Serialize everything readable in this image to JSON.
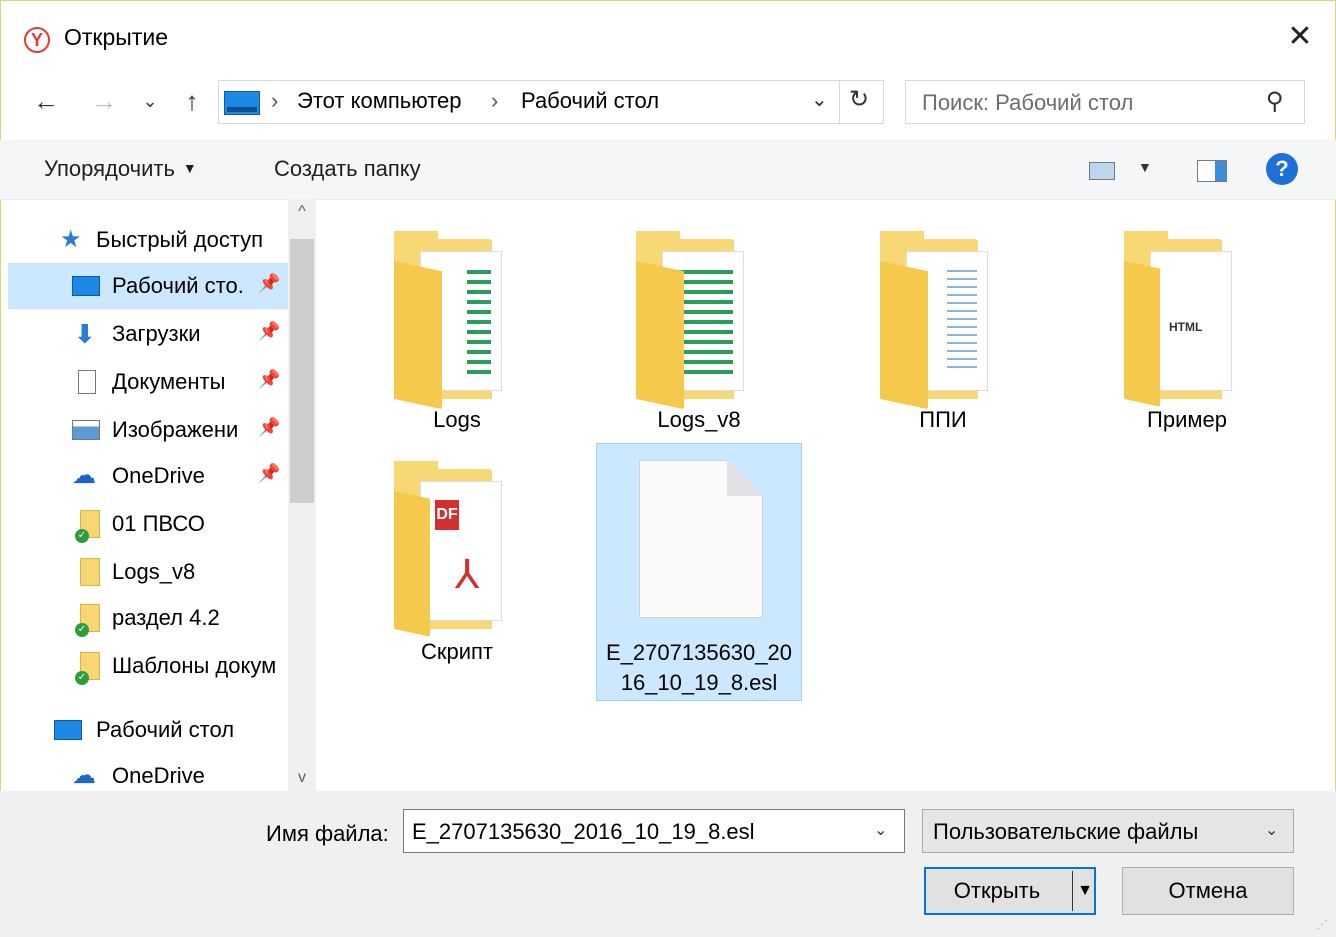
{
  "window": {
    "title": "Открытие",
    "close_symbol": "✕"
  },
  "nav": {
    "back": "←",
    "forward": "→",
    "recent": "⌄",
    "up": "↑",
    "breadcrumbs": [
      "Этот компьютер",
      "Рабочий стол"
    ],
    "sep": "›",
    "dropdown": "⌄",
    "refresh": "↻",
    "search_placeholder": "Поиск: Рабочий стол",
    "search_icon_glyph": "⚲"
  },
  "commands": {
    "organize": "Упорядочить",
    "new_folder": "Создать папку",
    "help": "?"
  },
  "sidebar": {
    "items": [
      {
        "label": "Быстрый доступ",
        "icon": "star-icon"
      },
      {
        "label": "Рабочий сто.",
        "icon": "desktop-icon",
        "pinned": "📌"
      },
      {
        "label": "Загрузки",
        "icon": "download-icon",
        "pinned": "📌"
      },
      {
        "label": "Документы",
        "icon": "document-icon",
        "pinned": "📌"
      },
      {
        "label": "Изображени",
        "icon": "image-icon",
        "pinned": "📌"
      },
      {
        "label": "OneDrive",
        "icon": "onedrive-icon",
        "pinned": "📌"
      },
      {
        "label": "01 ПВСО",
        "icon": "folder-synced-icon"
      },
      {
        "label": "Logs_v8",
        "icon": "folder-icon"
      },
      {
        "label": "раздел 4.2",
        "icon": "folder-synced-icon"
      },
      {
        "label": "Шаблоны докум",
        "icon": "folder-synced-icon"
      },
      {
        "label": "Рабочий стол",
        "icon": "desktop-icon"
      },
      {
        "label": "OneDrive",
        "icon": "onedrive-icon"
      }
    ],
    "scroll_up": "^",
    "scroll_down": "v"
  },
  "files": [
    {
      "name": "Logs",
      "type": "folder"
    },
    {
      "name": "Logs_v8",
      "type": "folder"
    },
    {
      "name": "ППИ",
      "type": "folder"
    },
    {
      "name": "Пример",
      "type": "folder"
    },
    {
      "name": "Скрипт",
      "type": "folder"
    },
    {
      "name_line1": "E_2707135630_20",
      "name_line2": "16_10_19_8.esl",
      "type": "file",
      "selected": true
    }
  ],
  "pdf_badge": "DF",
  "html_badge": "HTML",
  "bottom": {
    "filename_label": "Имя файла:",
    "filename_value": "E_2707135630_2016_10_19_8.esl",
    "filetype_value": "Пользовательские файлы",
    "open_label": "Открыть",
    "cancel_label": "Отмена",
    "chevron": "⌄",
    "split_arrow": "▼"
  },
  "colors": {
    "accent": "#0078d7",
    "selection": "#cce8ff",
    "folder": "#f8d775"
  }
}
